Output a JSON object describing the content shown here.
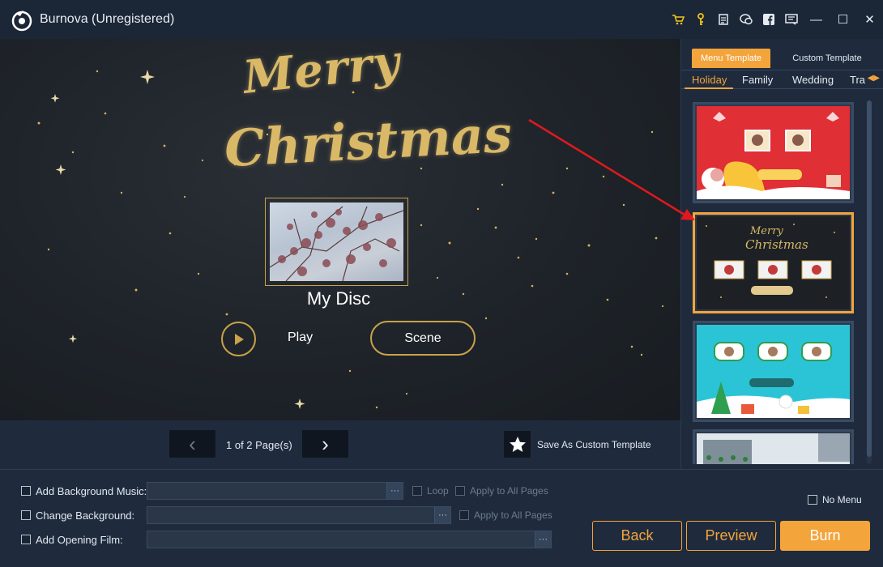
{
  "app": {
    "title": "Burnova (Unregistered)"
  },
  "titlebar": {
    "icons": [
      "cart-icon",
      "key-icon",
      "document-icon",
      "chat-icon",
      "facebook-icon",
      "feedback-icon"
    ],
    "window_controls": {
      "minimize": "—",
      "maximize": "☐",
      "close": "✕"
    }
  },
  "preview": {
    "heading_line1": "Merry",
    "heading_line2": "Christmas",
    "disc_title": "My Disc",
    "play_label": "Play",
    "scene_label": "Scene"
  },
  "pager": {
    "prev": "‹",
    "next": "›",
    "page_text": "1 of 2 Page(s)",
    "save_template_label": "Save As Custom Template"
  },
  "templates": {
    "tabs": [
      "Menu Template",
      "Custom Template"
    ],
    "active_tab": "Menu Template",
    "categories": [
      "Holiday",
      "Family",
      "Wedding",
      "Tra"
    ],
    "active_category": "Holiday",
    "selected_index": 1
  },
  "bottom": {
    "bg_music_label": "Add Background Music:",
    "loop_label": "Loop",
    "apply_all_1": "Apply to All Pages",
    "change_bg_label": "Change Background:",
    "apply_all_2": "Apply to All Pages",
    "opening_film_label": "Add Opening Film:",
    "browse": "···",
    "no_menu_label": "No Menu",
    "back_label": "Back",
    "preview_label": "Preview",
    "burn_label": "Burn"
  },
  "colors": {
    "accent": "#f3a43b",
    "background": "#1f2b3d",
    "gold": "#c9a24a"
  }
}
